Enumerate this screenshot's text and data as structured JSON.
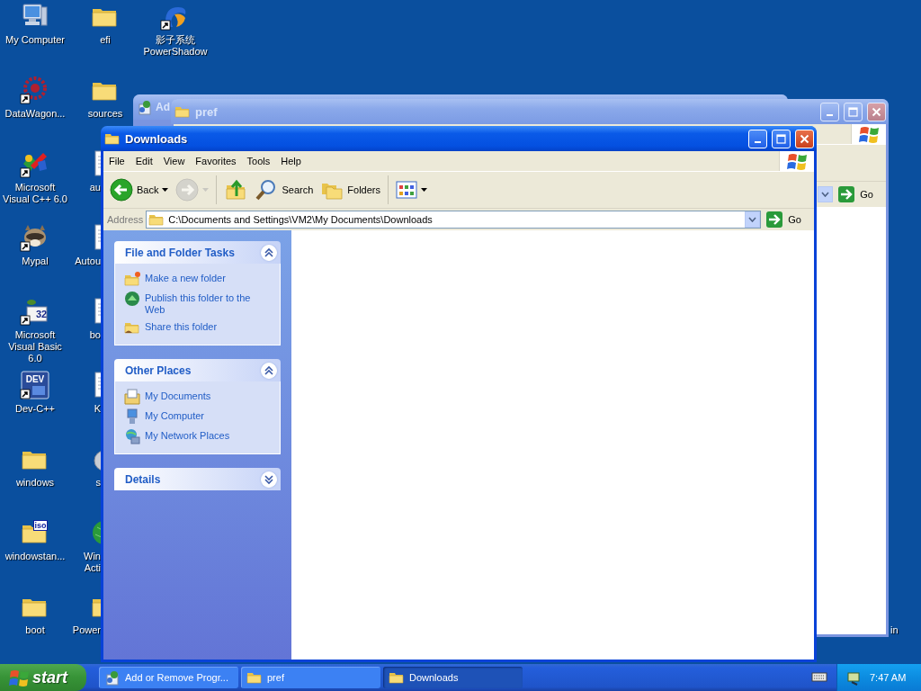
{
  "desktop_columns": [
    [
      {
        "label": "My Computer",
        "kind": "computer",
        "shortcut": false
      },
      {
        "label": "DataWagon...",
        "kind": "gear",
        "shortcut": true
      },
      {
        "label": "Microsoft Visual C++ 6.0",
        "kind": "tools",
        "shortcut": true
      },
      {
        "label": "Mypal",
        "kind": "animal",
        "shortcut": true
      },
      {
        "label": "Microsoft Visual Basic 6.0",
        "kind": "badge-app",
        "badge": "32",
        "shortcut": true
      },
      {
        "label": "Dev-C++",
        "kind": "badge-square",
        "badge": "DEV",
        "shortcut": true
      },
      {
        "label": "windows",
        "kind": "folder",
        "shortcut": false
      },
      {
        "label": "windowstan...",
        "kind": "badge-folder",
        "badge": "iso",
        "shortcut": false
      },
      {
        "label": "boot",
        "kind": "folder",
        "shortcut": false
      }
    ],
    [
      {
        "label": "efi",
        "kind": "folder",
        "shortcut": false
      },
      {
        "label": "sources",
        "kind": "folder",
        "shortcut": false
      },
      {
        "label": "au",
        "kind": "document",
        "shortcut": false
      },
      {
        "label": "Autou",
        "kind": "document",
        "shortcut": false
      },
      {
        "label": "bo",
        "kind": "document",
        "shortcut": false
      },
      {
        "label": "K",
        "kind": "document",
        "shortcut": false
      },
      {
        "label": "s",
        "kind": "disc",
        "shortcut": false
      },
      {
        "label": "Win Acti",
        "kind": "globe",
        "shortcut": false
      },
      {
        "label": "Power",
        "kind": "folder",
        "shortcut": false
      }
    ],
    [
      {
        "label": "影子系统 PowerShadow",
        "kind": "swirl",
        "shortcut": true
      }
    ]
  ],
  "desktop_edge_label": "in",
  "background_window": {
    "title": "Ad"
  },
  "pref_window": {
    "title": "pref",
    "go": "Go"
  },
  "downloads_window": {
    "title": "Downloads",
    "menu": [
      "File",
      "Edit",
      "View",
      "Favorites",
      "Tools",
      "Help"
    ],
    "toolbar": [
      {
        "kind": "back",
        "label": "Back",
        "disabled": false,
        "dropdown": true
      },
      {
        "kind": "forward",
        "disabled": true,
        "dropdown": true
      },
      {
        "kind": "up",
        "disabled": false,
        "dropdown": false
      },
      {
        "kind": "search",
        "label": "Search",
        "disabled": false,
        "dropdown": false
      },
      {
        "kind": "folders",
        "label": "Folders",
        "disabled": false,
        "dropdown": false
      },
      {
        "kind": "views",
        "disabled": false,
        "dropdown": true
      }
    ],
    "address": {
      "label": "Address",
      "value": "C:\\Documents and Settings\\VM2\\My Documents\\Downloads",
      "go": "Go"
    },
    "task_panes": [
      {
        "title": "File and Folder Tasks",
        "expanded": true,
        "items": [
          {
            "label": "Make a new folder",
            "kind": "new-folder"
          },
          {
            "label": "Publish this folder to the Web",
            "kind": "globe"
          },
          {
            "label": "Share this folder",
            "kind": "share-folder"
          }
        ]
      },
      {
        "title": "Other Places",
        "expanded": true,
        "items": [
          {
            "label": "My Documents",
            "kind": "documents"
          },
          {
            "label": "My Computer",
            "kind": "computer"
          },
          {
            "label": "My Network Places",
            "kind": "network"
          }
        ]
      },
      {
        "title": "Details",
        "expanded": false
      }
    ]
  },
  "taskbar": {
    "start": "start",
    "tasks": [
      {
        "label": "Add or Remove Progr...",
        "kind": "installer",
        "selected": false
      },
      {
        "label": "pref",
        "kind": "folder",
        "selected": false
      },
      {
        "label": "Downloads",
        "kind": "folder",
        "selected": true
      }
    ],
    "clock": "7:47 AM"
  }
}
